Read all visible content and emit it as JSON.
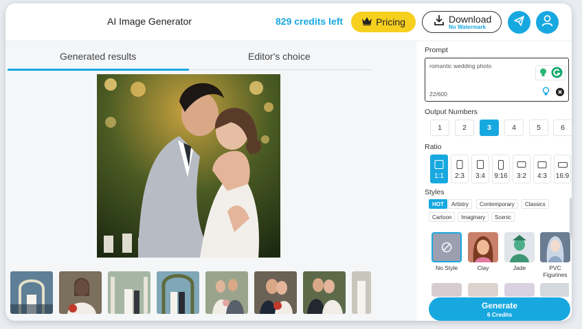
{
  "app": {
    "title": "AI Image Generator",
    "credits": "829 credits left"
  },
  "header": {
    "pricing_label": "Pricing",
    "download_label": "Download",
    "download_sub": "No Watermark"
  },
  "tabs": [
    {
      "label": "Generated results"
    },
    {
      "label": "Editor's choice"
    }
  ],
  "prompt": {
    "label": "Prompt",
    "value": "romantic wedding photo",
    "count": "22/600"
  },
  "output": {
    "label": "Output Numbers",
    "options": [
      "1",
      "2",
      "3",
      "4",
      "5",
      "6"
    ],
    "selected": "3"
  },
  "ratio": {
    "label": "Ratio",
    "options": [
      "1:1",
      "2:3",
      "3:4",
      "9:16",
      "3:2",
      "4:3",
      "16:9"
    ],
    "selected": "1:1"
  },
  "styles": {
    "label": "Styles",
    "tags": [
      "HOT",
      "Artistry",
      "Contemporary",
      "Classics",
      "Cartoon",
      "Imaginary",
      "Scenic"
    ],
    "selected_tag": "HOT",
    "cards": [
      {
        "name": "No Style"
      },
      {
        "name": "Clay"
      },
      {
        "name": "Jade"
      },
      {
        "name": "PVC Figurines"
      }
    ]
  },
  "generate": {
    "label": "Generate",
    "sub": "6 Credits"
  },
  "colors": {
    "accent": "#18a8e0",
    "pricing": "#f7cf1f"
  },
  "icons": [
    "crown-icon",
    "download-icon",
    "send-icon",
    "user-icon",
    "lightbulb-icon",
    "grammar-icon",
    "clear-icon",
    "no-style-icon"
  ]
}
